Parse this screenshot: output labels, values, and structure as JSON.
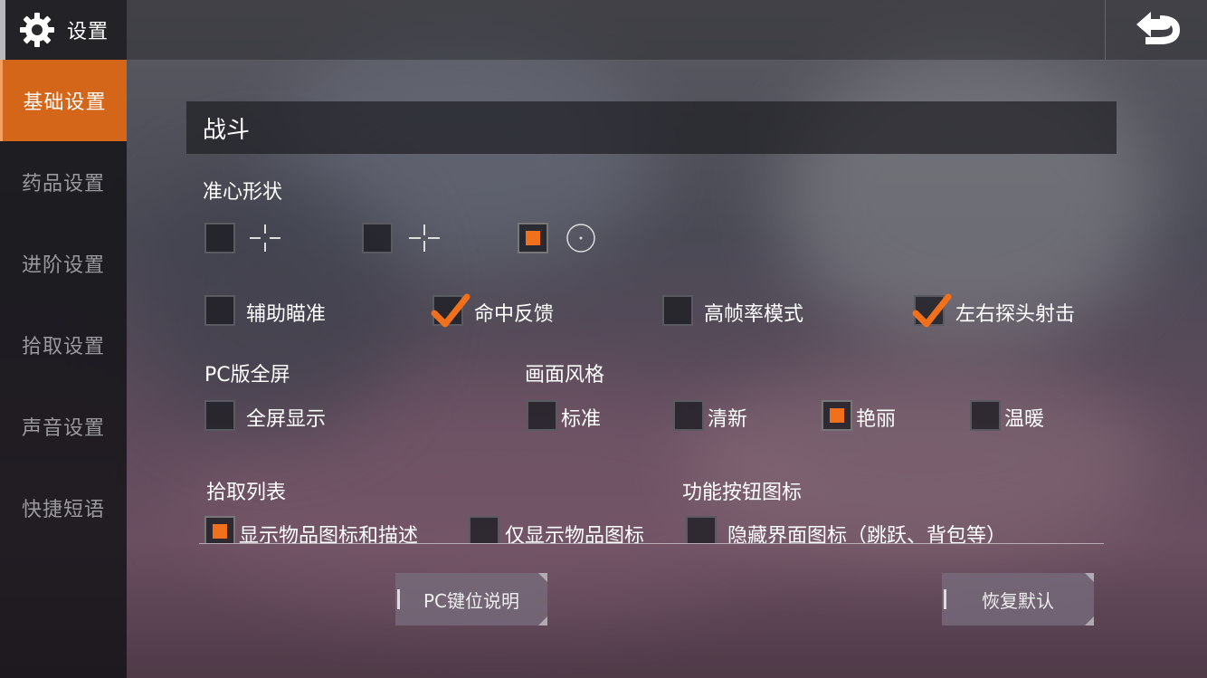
{
  "header": {
    "title": "设置",
    "icons": {
      "settings": "gear-icon",
      "back": "back-arrow-icon"
    }
  },
  "sidebar": {
    "items": [
      {
        "label": "基础设置",
        "active": true
      },
      {
        "label": "药品设置",
        "active": false
      },
      {
        "label": "进阶设置",
        "active": false
      },
      {
        "label": "拾取设置",
        "active": false
      },
      {
        "label": "声音设置",
        "active": false
      },
      {
        "label": "快捷短语",
        "active": false
      }
    ]
  },
  "main": {
    "section_title": "战斗",
    "crosshair": {
      "label": "准心形状",
      "options": [
        {
          "icon": "crosshair-gap-icon",
          "checked": false
        },
        {
          "icon": "crosshair-cross-icon",
          "checked": false
        },
        {
          "icon": "crosshair-dot-circle-icon",
          "checked": true
        }
      ]
    },
    "combat_options": [
      {
        "label": "辅助瞄准",
        "checked": false
      },
      {
        "label": "命中反馈",
        "checked": true
      },
      {
        "label": "高帧率模式",
        "checked": false
      },
      {
        "label": "左右探头射击",
        "checked": true
      }
    ],
    "pc_fullscreen": {
      "label": "PC版全屏",
      "option": "全屏显示",
      "checked": false
    },
    "visual_style": {
      "label": "画面风格",
      "options": [
        {
          "label": "标准",
          "checked": false
        },
        {
          "label": "清新",
          "checked": false
        },
        {
          "label": "艳丽",
          "checked": true
        },
        {
          "label": "温暖",
          "checked": false
        }
      ]
    },
    "pickup_list": {
      "label": "拾取列表",
      "options": [
        {
          "label": "显示物品图标和描述",
          "checked": true
        },
        {
          "label": "仅显示物品图标",
          "checked": false
        }
      ]
    },
    "function_icons": {
      "label": "功能按钮图标",
      "option": "隐藏界面图标（跳跃、背包等）",
      "checked": false
    }
  },
  "footer": {
    "pc_keys_label": "PC键位说明",
    "reset_label": "恢复默认"
  },
  "colors": {
    "accent": "#d4661a",
    "check": "#f0701c"
  }
}
